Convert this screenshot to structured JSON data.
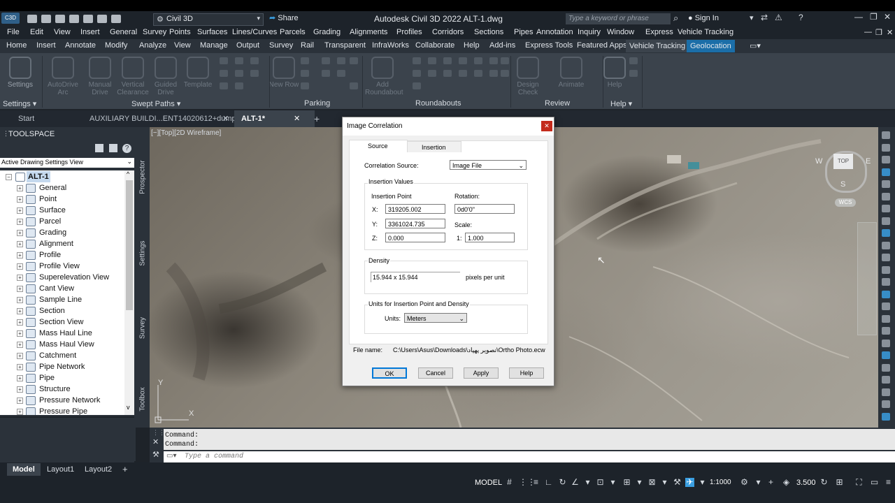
{
  "app": {
    "title": "Autodesk Civil 3D 2022   ALT-1.dwg",
    "workspace": "Civil 3D",
    "share": "Share",
    "search_placeholder": "Type a keyword or phrase",
    "sign_in": "Sign In"
  },
  "menubar": [
    "File",
    "Edit",
    "View",
    "Insert",
    "General",
    "Survey",
    "Points",
    "Surfaces",
    "Lines/Curves",
    "Parcels",
    "Grading",
    "Alignments",
    "Profiles",
    "Corridors",
    "Sections",
    "Pipes",
    "Annotation",
    "Inquiry",
    "Window",
    "Express",
    "Vehicle Tracking"
  ],
  "ribbon_tabs": [
    "Home",
    "Insert",
    "Annotate",
    "Modify",
    "Analyze",
    "View",
    "Manage",
    "Output",
    "Survey",
    "Rail",
    "Transparent",
    "InfraWorks",
    "Collaborate",
    "Help",
    "Add-ins",
    "Express Tools",
    "Featured Apps",
    "Vehicle Tracking",
    "Geolocation"
  ],
  "ribbon": {
    "buttons": [
      "Settings",
      "AutoDrive Arc",
      "Manual Drive",
      "Vertical Clearance",
      "Guided Drive",
      "Template",
      "New Row",
      "Add Roundabout",
      "Design Check",
      "Animate",
      "Help"
    ],
    "panels": [
      "Settings",
      "Swept Paths",
      "Parking",
      "Roundabouts",
      "Review",
      "Help"
    ]
  },
  "doc_tabs": {
    "start": "Start",
    "file1": "AUXILIARY BUILDI...ENT14020612+dump*",
    "file2": "ALT-1*",
    "new": "+"
  },
  "toolspace": {
    "title": "TOOLSPACE",
    "view_select": "Active Drawing Settings View",
    "root": "ALT-1",
    "items": [
      "General",
      "Point",
      "Surface",
      "Parcel",
      "Grading",
      "Alignment",
      "Profile",
      "Profile View",
      "Superelevation View",
      "Cant View",
      "Sample Line",
      "Section",
      "Section View",
      "Mass Haul Line",
      "Mass Haul View",
      "Catchment",
      "Pipe Network",
      "Pipe",
      "Structure",
      "Pressure Network",
      "Pressure Pipe"
    ],
    "side_tabs": [
      "Prospector",
      "Settings",
      "Survey",
      "Toolbox"
    ]
  },
  "viewport": {
    "label": "[−][Top][2D Wireframe]",
    "viewcube_top": "TOP",
    "viewcube_w": "W",
    "viewcube_e": "E",
    "viewcube_s": "S",
    "wcs": "WCS",
    "axis_y": "Y",
    "axis_x": "X"
  },
  "command": {
    "line1": "Command:",
    "line2": "Command:",
    "placeholder": "Type a command"
  },
  "layout_tabs": [
    "Model",
    "Layout1",
    "Layout2",
    "+"
  ],
  "status": {
    "model": "MODEL",
    "scale": "1:1000",
    "elevation": "3.500"
  },
  "dialog": {
    "title": "Image Correlation",
    "close": "✕",
    "tabs": [
      "Source",
      "Insertion"
    ],
    "correlation_source_label": "Correlation Source:",
    "correlation_source_value": "Image File",
    "insertion_values_label": "Insertion Values",
    "insertion_point_label": "Insertion Point",
    "rotation_label": "Rotation:",
    "x_label": "X:",
    "x_value": "319205.002",
    "y_label": "Y:",
    "y_value": "3361024.735",
    "z_label": "Z:",
    "z_value": "0.000",
    "rotation_value": "0d0'0\"",
    "scale_label": "Scale:",
    "scale_prefix": "1:",
    "scale_value": "1.000",
    "density_label": "Density",
    "density_value": "15.944 x 15.944",
    "density_unit": "pixels per unit",
    "units_group_label": "Units for Insertion Point and Density",
    "units_label": "Units:",
    "units_value": "Meters",
    "file_name_label": "File name:",
    "file_name_value": "C:\\Users\\Asus\\Downloads\\تصویر پهپاد\\Ortho Photo.ecw",
    "buttons": [
      "OK",
      "Cancel",
      "Apply",
      "Help"
    ]
  }
}
